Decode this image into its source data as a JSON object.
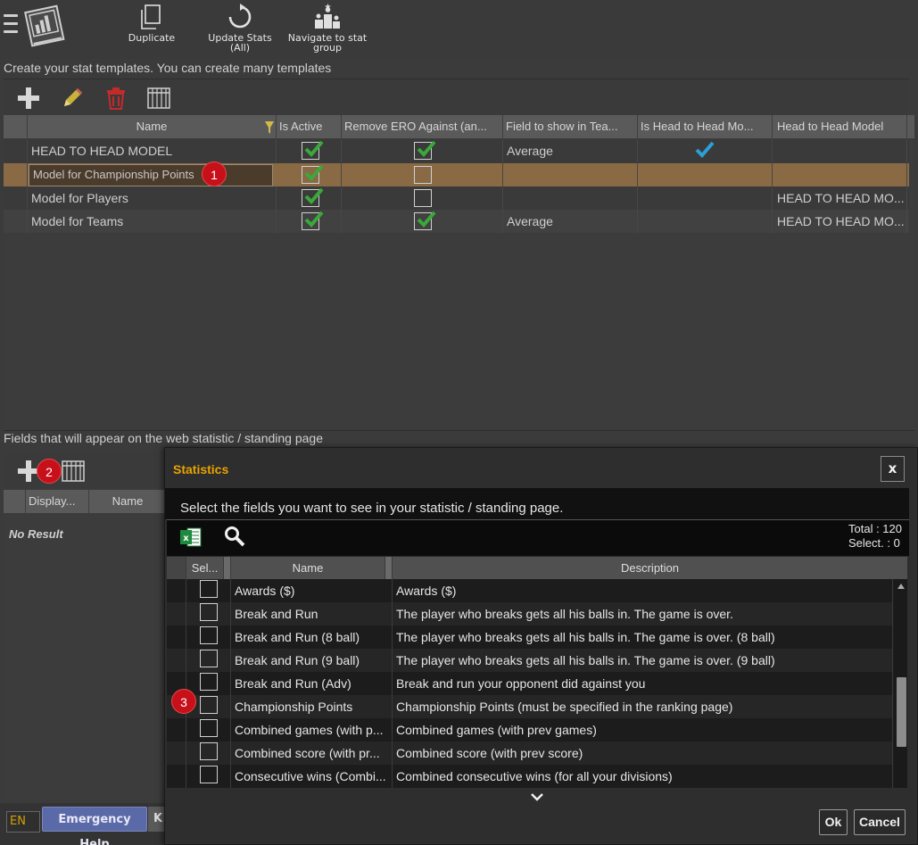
{
  "toolbar": {
    "duplicate_label": "Duplicate",
    "update_stats_label": "Update Stats\n(All)",
    "update_stats_line1": "Update Stats",
    "update_stats_line2": "(All)",
    "navigate_line1": "Navigate to stat",
    "navigate_line2": "group"
  },
  "templates_section": {
    "label": "Create your stat templates. You can create many templates",
    "columns": [
      "Name",
      "Is Active",
      "Remove ERO Against (an...",
      "Field to show in Tea...",
      "Is Head to Head Mo...",
      "Head to Head Model"
    ],
    "rows": [
      {
        "name": "HEAD TO HEAD MODEL",
        "is_active": true,
        "remove_ero": true,
        "field_to_show": "Average",
        "is_head_to_head": true,
        "head_to_head_model": ""
      },
      {
        "name": "Model for Championship Points",
        "is_active": true,
        "remove_ero": false,
        "field_to_show": "",
        "is_head_to_head": false,
        "head_to_head_model": ""
      },
      {
        "name": "Model for Players",
        "is_active": true,
        "remove_ero": false,
        "field_to_show": "",
        "is_head_to_head": false,
        "head_to_head_model": "HEAD TO HEAD MO..."
      },
      {
        "name": "Model for Teams",
        "is_active": true,
        "remove_ero": true,
        "field_to_show": "Average",
        "is_head_to_head": false,
        "head_to_head_model": "HEAD TO HEAD MO..."
      }
    ],
    "selected_row_index": 1
  },
  "fields_section": {
    "label": "Fields that will appear on the web statistic / standing page",
    "columns": [
      "Display...",
      "Name"
    ],
    "empty_text": "No Result"
  },
  "modal": {
    "title": "Statistics",
    "close_label": "x",
    "instruction": "Select the fields you want to see in your statistic / standing page.",
    "total_label": "Total : 120",
    "selected_label": "Select. : 0",
    "columns": [
      "Sel...",
      "Name",
      "Description"
    ],
    "rows": [
      {
        "name": "Awards ($)",
        "description": "Awards ($)"
      },
      {
        "name": "Break and Run",
        "description": "The player who breaks gets all his balls in. The game is over."
      },
      {
        "name": "Break and Run (8 ball)",
        "description": "The player who breaks gets all his balls in. The game is over. (8 ball)"
      },
      {
        "name": "Break and Run (9 ball)",
        "description": "The player who breaks gets all his balls in. The game is over. (9 ball)"
      },
      {
        "name": "Break and Run (Adv)",
        "description": "Break and run your opponent did against you"
      },
      {
        "name": "Championship Points",
        "description": "Championship Points (must be specified in the ranking page)"
      },
      {
        "name": "Combined games (with p...",
        "description": "Combined games (with prev games)"
      },
      {
        "name": "Combined score (with pr...",
        "description": "Combined score (with prev score)"
      },
      {
        "name": "Consecutive wins (Combi...",
        "description": "Combined consecutive wins (for all your divisions)"
      }
    ],
    "ok_label": "Ok",
    "cancel_label": "Cancel"
  },
  "footer": {
    "language": "EN",
    "emergency_label": "Emergency Help",
    "k_label": "K"
  },
  "badges": [
    "1",
    "2",
    "3"
  ],
  "colors": {
    "accent_orange": "#e8a400",
    "selected_row": "#8a6a44",
    "check_green": "#3aa83a",
    "check_blue": "#2aa0d8",
    "badge_red": "#c8101a",
    "emergency_blue": "#5a6aa8"
  }
}
